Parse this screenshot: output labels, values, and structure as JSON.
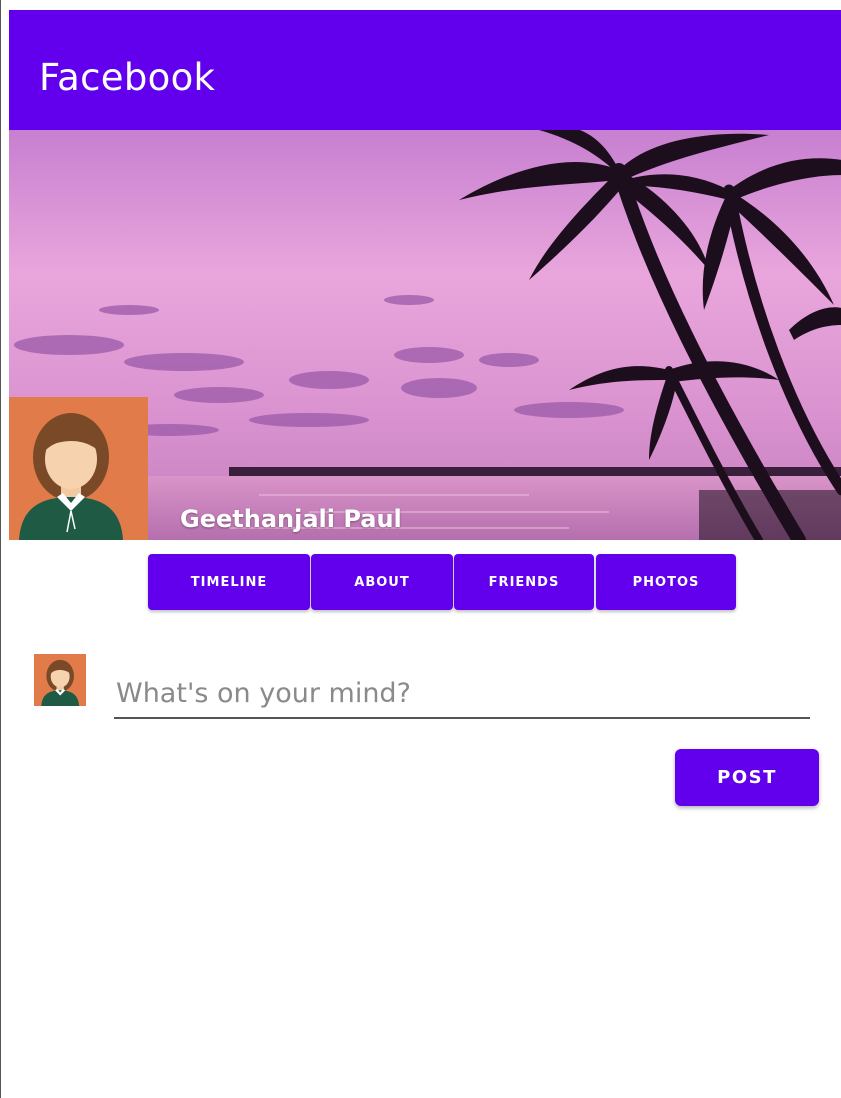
{
  "app_bar": {
    "title": "Facebook",
    "color": "#6200ee"
  },
  "profile": {
    "cover_image": "tropical-sunset-palm-trees",
    "profile_picture": "woman-avatar",
    "name": "Geethanjali Paul"
  },
  "tabs": [
    {
      "label": "TIMELINE"
    },
    {
      "label": "ABOUT"
    },
    {
      "label": "FRIENDS"
    },
    {
      "label": "PHOTOS"
    }
  ],
  "composer": {
    "avatar": "woman-avatar",
    "placeholder": "What's on your mind?",
    "value": "",
    "post_label": "POST"
  },
  "colors": {
    "accent": "#6200ee",
    "avatar_background": "#e27b4a"
  }
}
